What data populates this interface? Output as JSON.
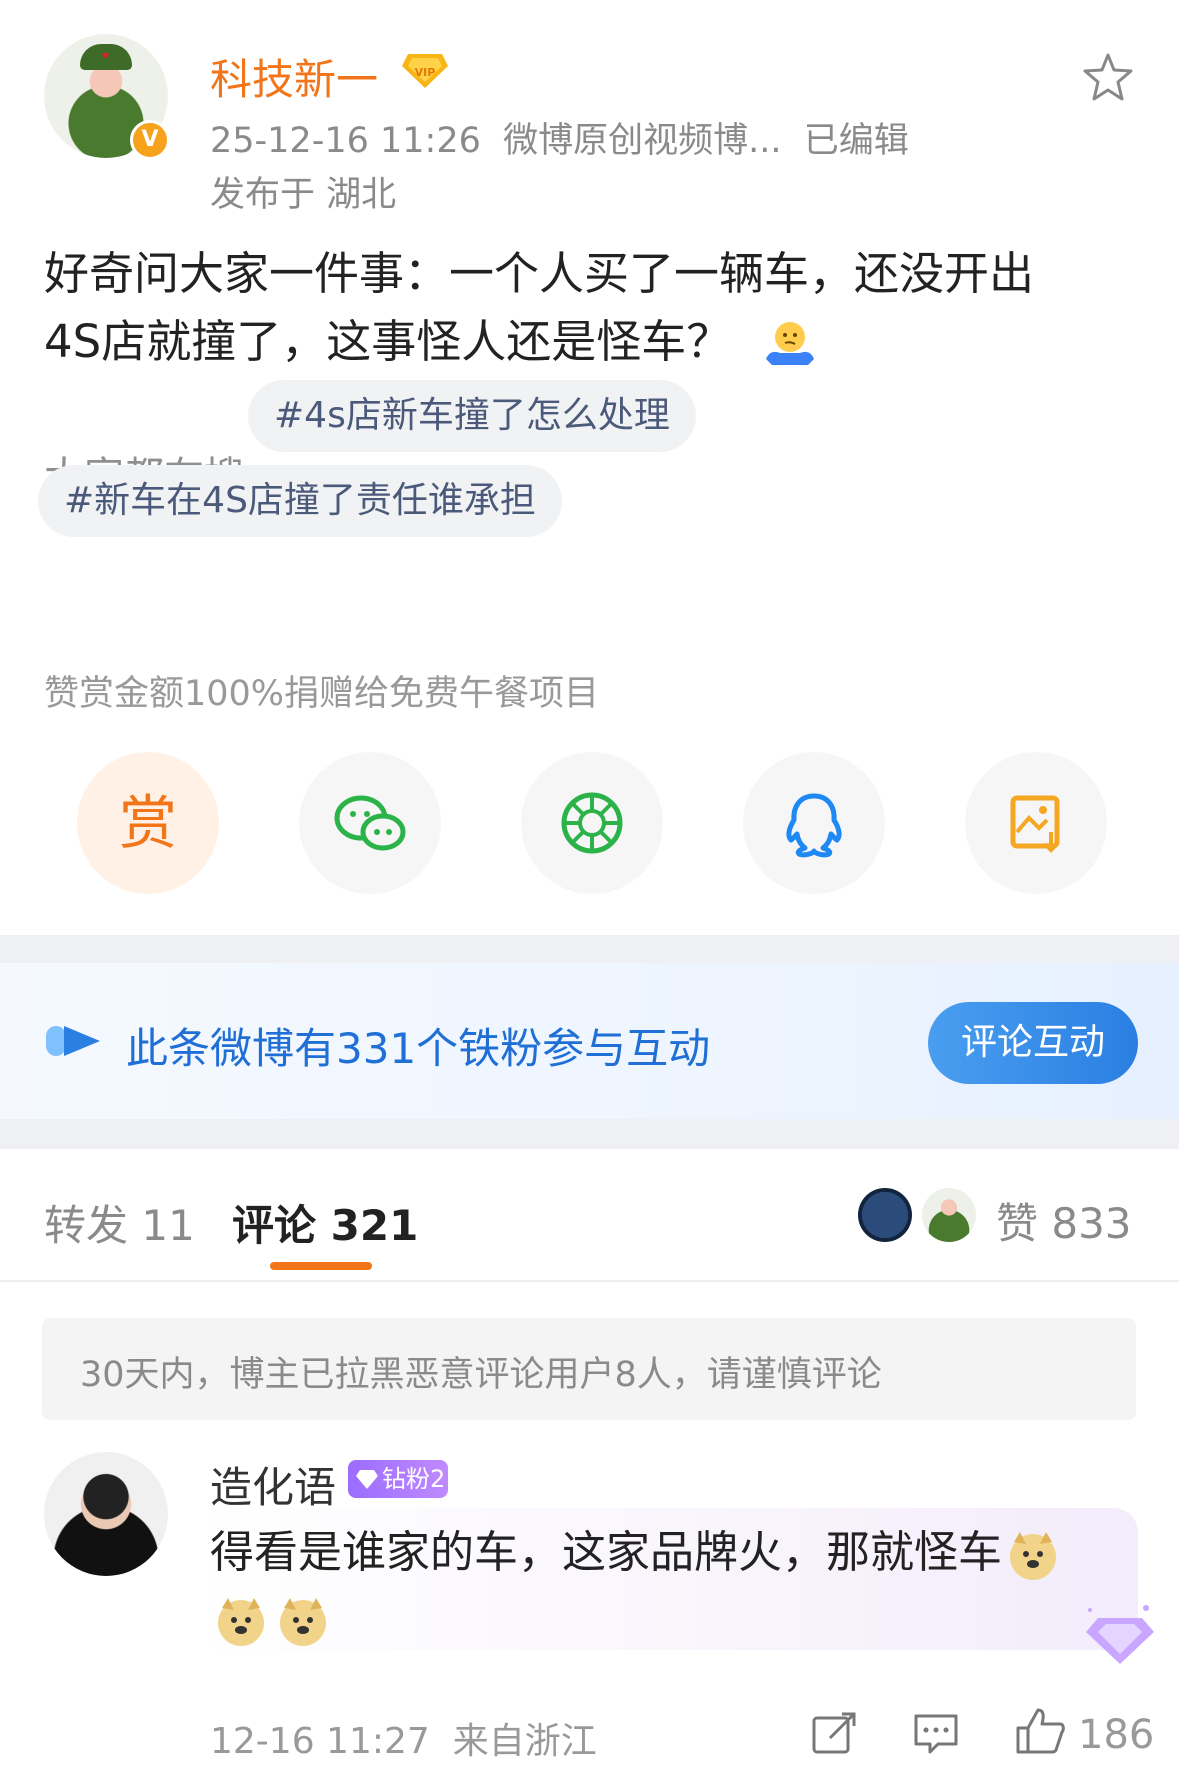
{
  "post": {
    "author": "科技新一",
    "verified_mark": "V",
    "vip_label": "VIP",
    "timestamp": "25-12-16 11:26",
    "source": "微博原创视频博...",
    "edited": "已编辑",
    "location": "发布于 湖北",
    "text_line1": "好奇问大家一件事：一个人买了一辆车，还没开出",
    "text_line2": "4S店就撞了，这事怪人还是怪车？"
  },
  "search": {
    "label": "大家都在搜",
    "tags": [
      "#4s店新车撞了怎么处理",
      "#新车在4S店撞了责任谁承担"
    ]
  },
  "reward": {
    "note": "赞赏金额100%捐赠给免费午餐项目",
    "reward_label": "赏"
  },
  "share_icons": [
    "reward-icon",
    "wechat-icon",
    "moments-icon",
    "qq-icon",
    "save-image-icon"
  ],
  "fans_bar": {
    "text": "此条微博有331个铁粉参与互动",
    "button": "评论互动"
  },
  "tabs": {
    "repost": "转发 11",
    "comments": "评论 321",
    "likes": "赞 833"
  },
  "notice": "30天内，博主已拉黑恶意评论用户8人，请谨慎评论",
  "comment": {
    "user": "造化语",
    "badge": "钻粉2",
    "text": "得看是谁家的车，这家品牌火，那就怪车",
    "time": "12-16 11:27",
    "location": "来自浙江",
    "likes": "186"
  },
  "colors": {
    "accent": "#f27619",
    "link": "#1f6fd6",
    "muted": "#8a8a8a"
  }
}
